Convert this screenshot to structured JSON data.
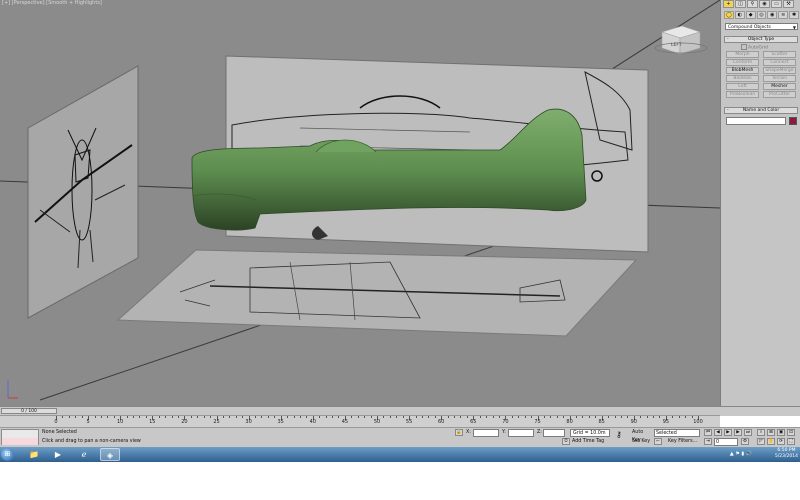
{
  "viewport": {
    "label": "[+] [Perspective] [Smooth + Highlights]",
    "viewcube_label": "LEFT"
  },
  "command_panel": {
    "tabs": [
      "+",
      "◫",
      "⚲",
      "◉",
      "▭",
      "⚒"
    ],
    "subtabs": [
      "◯",
      "◐",
      "◆",
      "◎",
      "◉",
      "≋",
      "✱"
    ],
    "category_dropdown": "Compound Objects",
    "object_type_title": "Object Type",
    "autogrid_label": "AutoGrid",
    "buttons": [
      {
        "label": "Morph",
        "enabled": false
      },
      {
        "label": "Scatter",
        "enabled": false
      },
      {
        "label": "Conform",
        "enabled": false
      },
      {
        "label": "Connect",
        "enabled": false
      },
      {
        "label": "BlobMesh",
        "enabled": true
      },
      {
        "label": "ShapeMerge",
        "enabled": false
      },
      {
        "label": "Boolean",
        "enabled": false
      },
      {
        "label": "Terrain",
        "enabled": false
      },
      {
        "label": "Loft",
        "enabled": false
      },
      {
        "label": "Mesher",
        "enabled": true
      },
      {
        "label": "ProBoolean",
        "enabled": false
      },
      {
        "label": "ProCutter",
        "enabled": false
      }
    ],
    "name_color_title": "Name and Color",
    "name_value": "",
    "object_color": "#8b1a3c"
  },
  "timeline": {
    "slider_label": "0 / 100",
    "ticks": [
      "0",
      "5",
      "10",
      "15",
      "20",
      "25",
      "30",
      "35",
      "40",
      "45",
      "50",
      "55",
      "60",
      "65",
      "70",
      "75",
      "80",
      "85",
      "90",
      "95",
      "100"
    ]
  },
  "status": {
    "selection": "None Selected",
    "prompt": "Click and drag to pan a non-camera view",
    "x_label": "X:",
    "y_label": "Y:",
    "z_label": "Z:",
    "grid": "Grid = 10.0m",
    "add_time_tag": "Add Time Tag",
    "auto_key": "Auto Key",
    "selected_dropdown": "Selected",
    "set_key": "Set Key",
    "key_filters": "Key Filters...",
    "frame": "0"
  },
  "taskbar": {
    "time": "6:50 PM",
    "date": "5/23/2014"
  }
}
